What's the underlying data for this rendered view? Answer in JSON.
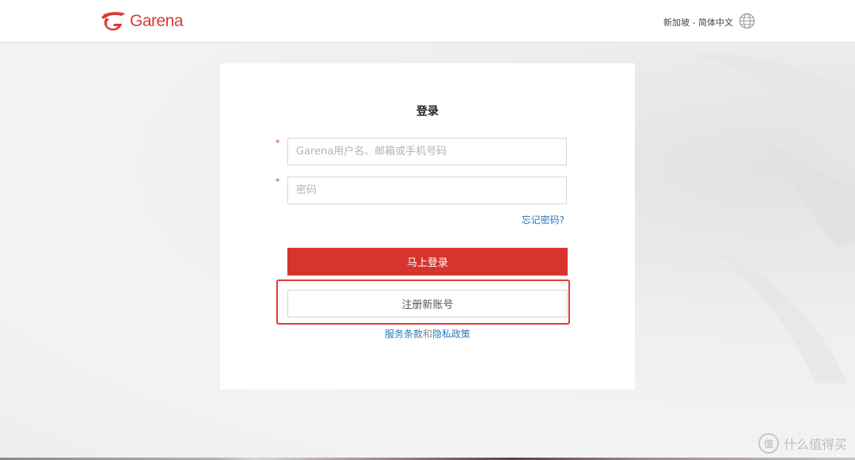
{
  "header": {
    "brand": "Garena",
    "region_language": "新加坡 - 简体中文",
    "globe_icon": "globe-icon"
  },
  "login": {
    "title": "登录",
    "required_mark": "*",
    "username_placeholder": "Garena用户名、邮箱或手机号码",
    "password_placeholder": "密码",
    "forgot_password": "忘记密码?",
    "login_button": "马上登录",
    "register_button": "注册新账号",
    "terms_link": "服务条款",
    "terms_and": "和",
    "privacy_link": "隐私政策"
  },
  "watermark": {
    "badge": "值",
    "text": "什么值得买"
  },
  "colors": {
    "brand_red": "#d7342d",
    "link_blue": "#2b78b8",
    "highlight_red": "#e53935"
  }
}
